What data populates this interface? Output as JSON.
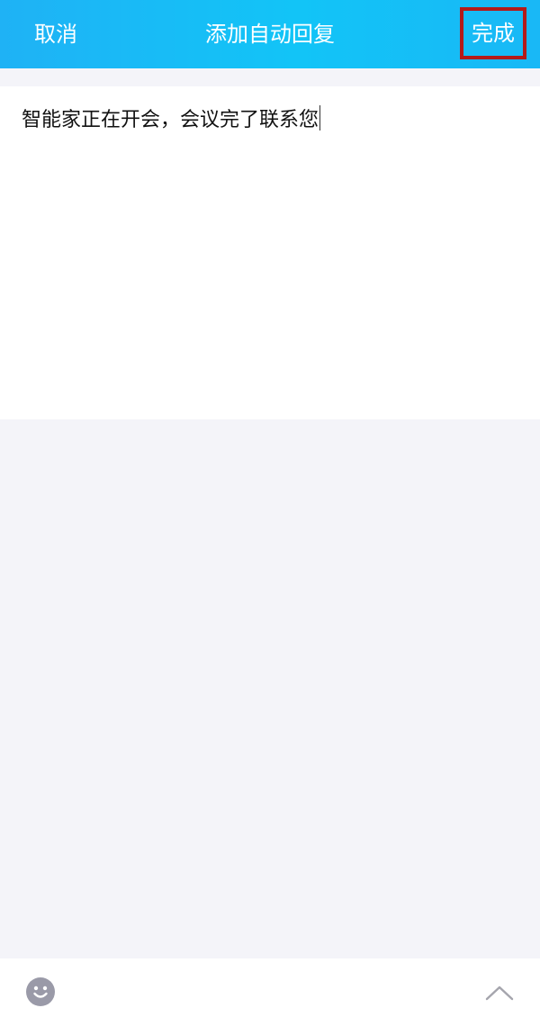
{
  "header": {
    "cancel_label": "取消",
    "title": "添加自动回复",
    "done_label": "完成"
  },
  "editor": {
    "text": "智能家正在开会，会议完了联系您"
  },
  "toolbar": {
    "emoji_icon": "smiley-face-icon",
    "collapse_icon": "chevron-up-icon"
  },
  "colors": {
    "header_start": "#1fb2f5",
    "header_end": "#19b8f6",
    "highlight_border": "#b41a1a",
    "background": "#f4f4f9",
    "icon_gray": "#9a9aa8"
  }
}
